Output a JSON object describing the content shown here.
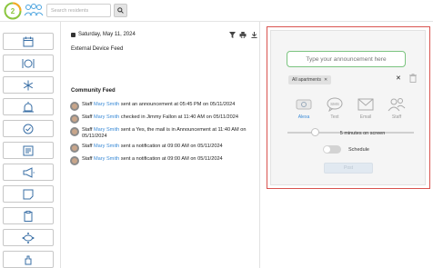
{
  "search": {
    "placeholder": "Search residents"
  },
  "feed": {
    "date": "Saturday, May 11, 2024",
    "external_title": "External Device Feed",
    "community_title": "Community Feed",
    "items": [
      {
        "prefix": "Staff ",
        "who": "Mary Smith",
        "text": " sent an announcement at 05:45 PM on 05/11/2024"
      },
      {
        "prefix": "Staff ",
        "who": "Mary Smith",
        "text": " checked in Jimmy Fallon at 11:40 AM on 05/11/2024"
      },
      {
        "prefix": "Staff ",
        "who": "Mary Smith",
        "text": " sent a Yes, the mail is in Announcement at 11:40 AM on 05/11/2024"
      },
      {
        "prefix": "Staff ",
        "who": "Mary Smith",
        "text": " sent a notification at 09:00 AM on 05/11/2024"
      },
      {
        "prefix": "Staff ",
        "who": "Mary Smith",
        "text": " sent a notification at 09:00 AM on 05/11/2024"
      }
    ]
  },
  "panel": {
    "placeholder": "Type your announcement here",
    "tag_label": "All apartments",
    "channels": {
      "alexa": "Alexa",
      "text": "Text",
      "email": "Email",
      "staff": "Staff"
    },
    "sms_glyph": "SMS",
    "duration_caption": "5 minutes on screen",
    "schedule_label": "Schedule",
    "post_label": "Post"
  },
  "rail": {
    "icons": [
      "calendar-icon",
      "dining-icon",
      "snowflake-icon",
      "alert-icon",
      "check-circle-icon",
      "newspaper-icon",
      "megaphone-icon",
      "note-icon",
      "clipboard-icon",
      "table-icon",
      "hand-icon",
      "more-icon"
    ]
  },
  "colors": {
    "accent": "#3a8ad6",
    "highlight": "#d9534f",
    "input_border": "#7bc47f"
  }
}
